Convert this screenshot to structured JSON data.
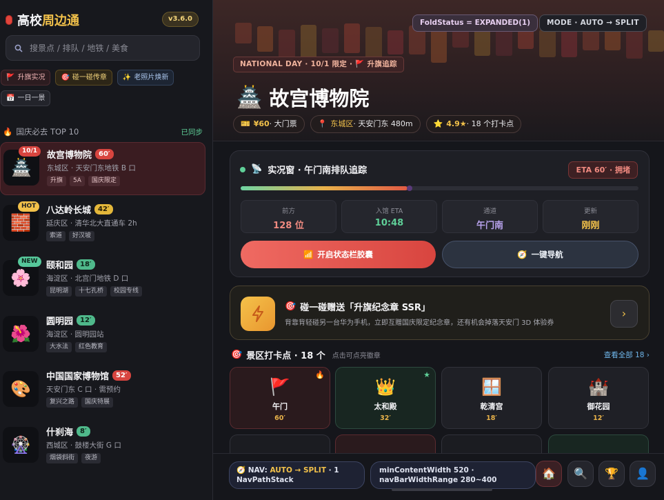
{
  "brand": {
    "part1": "高校",
    "part2": "周边通",
    "version": "v3.6.0"
  },
  "search": {
    "placeholder": "搜景点 / 排队 / 地铁 / 美食"
  },
  "chips": [
    "升旗实况",
    "碰一碰传章",
    "老照片焕新",
    "一日一景"
  ],
  "section": {
    "title": "国庆必去 TOP 10",
    "sync": "已同步"
  },
  "spots": [
    {
      "badge": "10/1",
      "name": "故宫博物院",
      "mins": "60′",
      "sub": "东城区 · 天安门东地铁 B 口",
      "tags": [
        "升旗",
        "5A",
        "国庆限定"
      ],
      "icon": "palace-icon",
      "glyph": "🏯"
    },
    {
      "badge": "HOT",
      "name": "八达岭长城",
      "mins": "42′",
      "sub": "延庆区 · 清华北大直通车 2h",
      "tags": [
        "索道",
        "好汉坡"
      ],
      "icon": "great-wall-icon",
      "glyph": "🧱"
    },
    {
      "badge": "NEW",
      "name": "颐和园",
      "mins": "18′",
      "sub": "海淀区 · 北宫门地铁 D 口",
      "tags": [
        "昆明湖",
        "十七孔桥",
        "校园专线"
      ],
      "icon": "cherry-blossom-icon",
      "glyph": "🌸"
    },
    {
      "badge": "",
      "name": "圆明园",
      "mins": "12′",
      "sub": "海淀区 · 圆明园站",
      "tags": [
        "大水法",
        "红色教育"
      ],
      "icon": "lotus-icon",
      "glyph": "🌺"
    },
    {
      "badge": "",
      "name": "中国国家博物馆",
      "mins": "52′",
      "sub": "天安门东 C 口 · 需预约",
      "tags": [
        "复兴之路",
        "国庆特展"
      ],
      "icon": "museum-art-icon",
      "glyph": "🎨"
    },
    {
      "badge": "",
      "name": "什刹海",
      "mins": "8′",
      "sub": "西城区 · 鼓楼大街 G 口",
      "tags": [
        "烟袋斜街",
        "夜游"
      ],
      "icon": "ferris-wheel-icon",
      "glyph": "🎡"
    }
  ],
  "hero": {
    "fold_status": "FoldStatus = EXPANDED(1)",
    "mode": "MODE · AUTO → SPLIT",
    "national": "NATIONAL DAY · 10/1 限定 · 🚩 升旗追踪",
    "title": "故宫博物院",
    "price": "¥60",
    "price_suffix": " · 大门票",
    "district": "东城区",
    "district_suffix": " · 天安门东 480m",
    "rating": "4.9★",
    "rating_suffix": " · 18 个打卡点"
  },
  "live": {
    "title": "实况窗 · 午门南排队追踪",
    "eta": "ETA 60′ · 拥堵",
    "progress": 0.42,
    "stats": [
      {
        "label": "前方",
        "value": "128 位",
        "color": "#f08a80"
      },
      {
        "label": "入馆 ETA",
        "value": "10:48",
        "color": "#5fcf98"
      },
      {
        "label": "通道",
        "value": "午门南",
        "color": "#b9a3ee"
      },
      {
        "label": "更新",
        "value": "刚刚",
        "color": "#f2c14a"
      }
    ],
    "btn_capsule": "开启状态栏胶囊",
    "btn_nav": "一键导航"
  },
  "promo": {
    "title": "碰一碰赠送「升旗纪念章 SSR」",
    "desc": "背靠背轻碰另一台华为手机，立即互赠国庆限定纪念章，还有机会掉落天安门 3D 体验券"
  },
  "checkpoints": {
    "title": "景区打卡点 · 18 个",
    "hint": "点击可点亮徽章",
    "view_all": "查看全部 18 ›",
    "cards": [
      {
        "name": "午门",
        "mins": "60′",
        "glyph": "🚩",
        "icon": "red-flag-icon",
        "corner": "🔥",
        "style": "hot"
      },
      {
        "name": "太和殿",
        "mins": "32′",
        "glyph": "👑",
        "icon": "crown-icon",
        "corner": "★",
        "style": "cool"
      },
      {
        "name": "乾清宫",
        "mins": "18′",
        "glyph": "🪟",
        "icon": "window-icon",
        "corner": "",
        "style": ""
      },
      {
        "name": "御花园",
        "mins": "12′",
        "glyph": "🏰",
        "icon": "castle-icon",
        "corner": "",
        "style": ""
      }
    ]
  },
  "bottom": {
    "nav_prefix": "NAV: ",
    "nav_mode": "AUTO → SPLIT",
    "nav_suffix": " · 1 NavPathStack",
    "width_info": "minContentWidth 520 · navBarWidthRange 280~400"
  },
  "colors": {
    "accent": "#d8453f",
    "gold": "#f2c14a",
    "green": "#5fcf98"
  }
}
